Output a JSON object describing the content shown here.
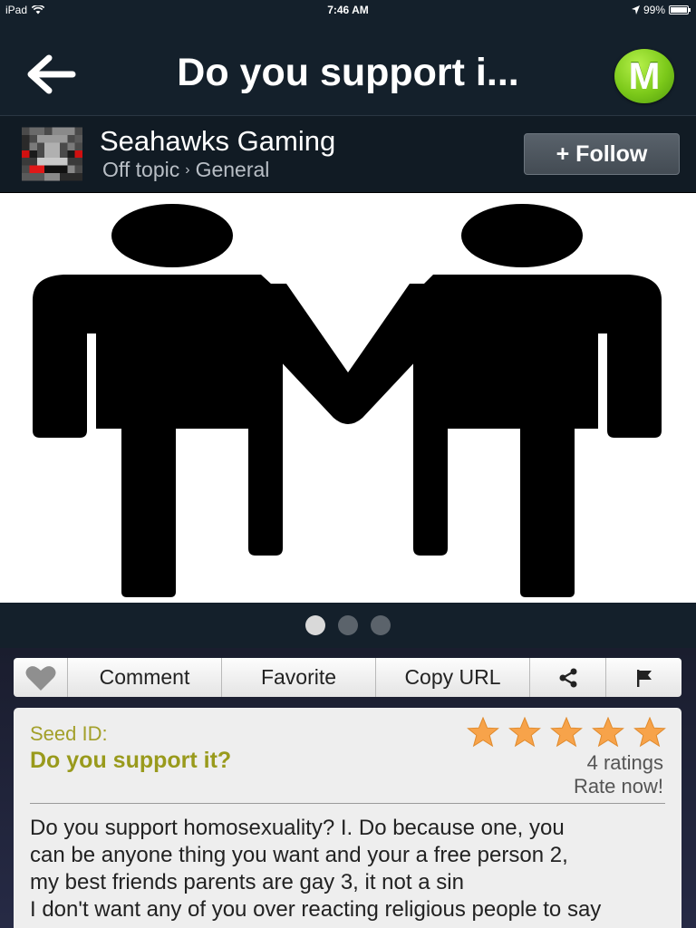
{
  "status_bar": {
    "device": "iPad",
    "time": "7:46 AM",
    "battery": "99%",
    "battery_level": 0.99
  },
  "nav": {
    "title": "Do you support i...",
    "logo_letter": "M"
  },
  "author": {
    "name": "Seahawks Gaming",
    "category": "Off topic",
    "subcategory": "General",
    "follow_label": "+ Follow"
  },
  "carousel": {
    "page_count": 3,
    "active_index": 0
  },
  "actions": {
    "comment": "Comment",
    "favorite": "Favorite",
    "copy_url": "Copy URL"
  },
  "seed": {
    "id_label": "Seed ID:",
    "title": "Do you support it?",
    "ratings": "4 ratings",
    "rate_now": "Rate now!",
    "star_rating": 5,
    "star_max": 5,
    "body": "Do you support homosexuality? I. Do because one, you\ncan be anyone thing you want and your a free person 2,\nmy best friends parents are gay 3, it not a sin\nI don't want any of you over reacting religious people to say"
  },
  "colors": {
    "nav_bg": "#14202b",
    "accent_green": "#7cc91a",
    "seed_olive": "#999a1c",
    "star_orange": "#f7a34a"
  }
}
